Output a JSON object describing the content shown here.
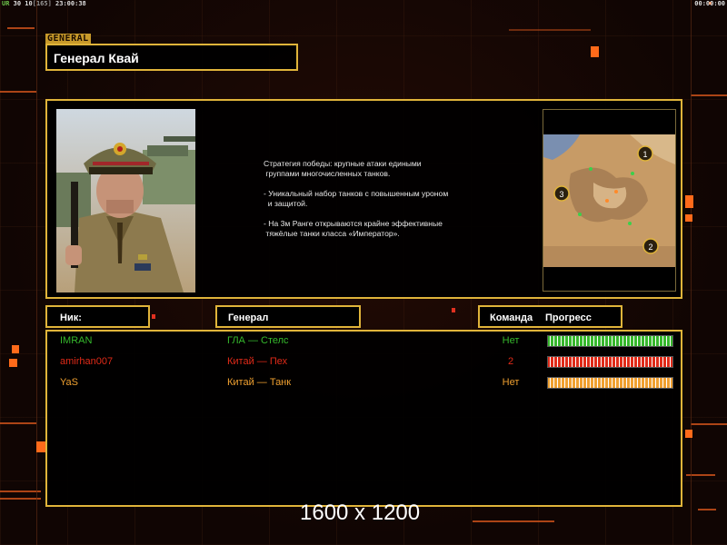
{
  "hud": {
    "left_prefix": "UR",
    "left_stats": "30 10",
    "left_bracket": "[165]",
    "left_time": "23:00:38",
    "right_time": "00:00:00"
  },
  "header": {
    "tag": "GENERAL",
    "title": "Генерал Квай"
  },
  "general": {
    "portrait_icon": "general-portrait-image",
    "description": "Стратегия победы: крупные атаки едиными\n группами многочисленных танков.\n\n- Уникальный набор танков с повышенным уроном\n  и защитой.\n\n- На 3м Ранге открываются крайне эффективные\n тяжёлые танки класса «Император».",
    "minimap_icon": "desert-map-preview",
    "start_markers": [
      "1",
      "2",
      "3"
    ]
  },
  "table": {
    "col_nick": "Ник:",
    "col_general": "Генерал",
    "col_team": "Команда",
    "col_progress": "Прогресс"
  },
  "players": [
    {
      "nick": "IMRAN",
      "general": "ГЛА — Стелс",
      "team": "Нет",
      "color": "#36b82c",
      "progress": 1.0
    },
    {
      "nick": "amirhan007",
      "general": "Китай — Пех",
      "team": "2",
      "color": "#e02a18",
      "progress": 1.0
    },
    {
      "nick": "YaS",
      "general": "Китай — Танк",
      "team": "Нет",
      "color": "#f0a030",
      "progress": 1.0
    }
  ],
  "overlay": {
    "resolution": "1600 x 1200"
  },
  "colors": {
    "frame": "#e0b43a",
    "accent": "#ff6a1a"
  }
}
